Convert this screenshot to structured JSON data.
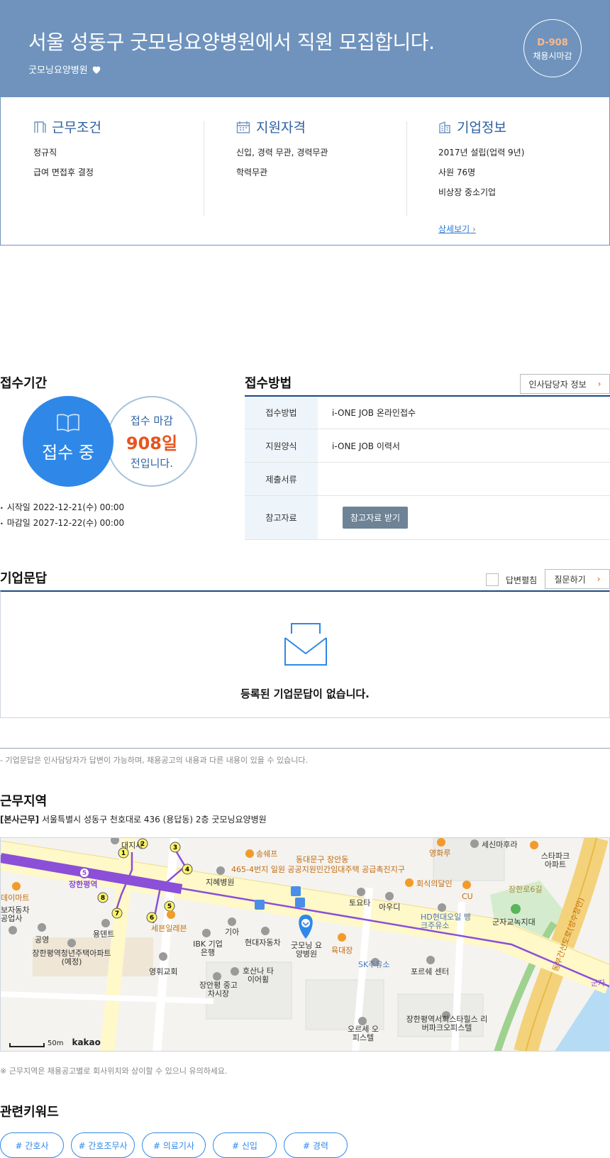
{
  "header": {
    "title": "서울 성동구 굿모닝요양병원에서 직원 모집합니다.",
    "company": "굿모닝요양병원",
    "dday": "D-908",
    "deadline_type": "채용시마감",
    "bg_color": "#6f93bd"
  },
  "conditions": {
    "work": {
      "title": "근무조건",
      "items": [
        "정규직",
        "급여 면접후 결정"
      ]
    },
    "qualification": {
      "title": "지원자격",
      "items": [
        "신입, 경력 무관, 경력무관",
        "학력무관"
      ]
    },
    "company_info": {
      "title": "기업정보",
      "items": [
        "2017년 설립(업력 9년)",
        "사원 76명",
        "비상장 중소기업"
      ],
      "more_link": "상세보기"
    }
  },
  "period": {
    "title": "접수기간",
    "status": "접수 중",
    "deadline_label": "접수 마감",
    "days_left": "908일",
    "suffix": "전입니다.",
    "start": "시작일 2022-12-21(수) 00:00",
    "end": "마감일 2027-12-22(수) 00:00"
  },
  "method": {
    "title": "접수방법",
    "hr_button": "인사담당자 정보",
    "rows": [
      {
        "key": "접수방법",
        "value": "i-ONE JOB 온라인접수"
      },
      {
        "key": "지원양식",
        "value": "i-ONE JOB 이력서"
      },
      {
        "key": "제출서류",
        "value": ""
      },
      {
        "key": "참고자료",
        "button": "참고자료 받기"
      }
    ]
  },
  "qa": {
    "title": "기업문답",
    "expand_label": "답변펼침",
    "ask_button": "질문하기",
    "empty_message": "등록된 기업문답이 없습니다.",
    "note": "- 기업문답은 인사담당자가 답변이 가능하며, 채용공고의 내용과 다른 내용이 있을 수 있습니다."
  },
  "location": {
    "title": "근무지역",
    "tag": "[본사근무]",
    "address": "서울특별시 성동구 천호대로 436 (용답동) 2층 굿모닝요양병원",
    "scale": "50m",
    "provider": "kakao",
    "note": "※ 근무지역은 채용공고별로 회사위치와 상이할 수 있으니 유의하세요.",
    "map_labels": {
      "station": "장한평역",
      "hospital_a": "지혜병원",
      "apt": "465-4번지 일원 공공지원민간임대주택 공급촉진지구",
      "district": "동대문구 장안동",
      "songshef": "송쉐프",
      "younghwaru": "영화루",
      "sesin": "세신마후라",
      "starpark": "스타파크 아파트",
      "hoesik": "회식의달인",
      "cu": "CU",
      "toyota": "토요타",
      "audi": "아우디",
      "hd_oil": "HD현대오일 뱅크주유소",
      "park": "군자교녹지대",
      "highway": "동부간선도로(성수장안)",
      "goodmorning": "굿모닝 요양병원",
      "yukdaejang": "육대장",
      "kia": "기아",
      "hyundai": "현대자동차",
      "ibk": "IBK 기업은행",
      "sebun": "세븐일레븐",
      "yongdent": "용덴트",
      "park2": "공영",
      "jangan_apt": "장한평역청년주택아파트 (예정)",
      "church": "영휘교회",
      "hosana": "호산나 타이어휠",
      "used_car": "장안평 중고차시장",
      "sk": "SK주유소",
      "porsche": "포르쉐 센터",
      "orse": "오르세 오피스텔",
      "river_office": "장한평역서희스타힐스 리버파크오피스텔",
      "hanpyeong_st": "장한로6길",
      "gunja": "군자",
      "emart": "데이마트",
      "bojang": "보자동차 공업사",
      "daeji": "대지사"
    }
  },
  "keywords": {
    "title": "관련키워드",
    "items": [
      "# 간호사",
      "# 간호조무사",
      "# 의료기사",
      "# 신입",
      "# 경력"
    ]
  }
}
